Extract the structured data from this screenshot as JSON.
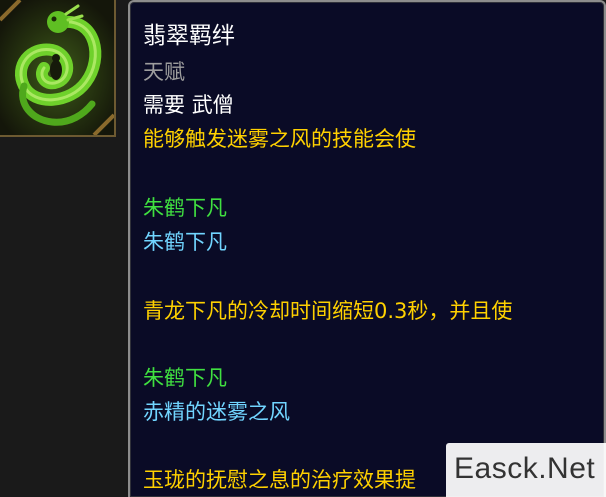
{
  "icon": {
    "name": "jade-serpent-icon"
  },
  "tooltip": {
    "title": "翡翠羁绊",
    "subtitle": "天赋",
    "requirement_prefix": "需要",
    "requirement_class": "武僧",
    "lines": [
      "能够触发迷雾之风的技能会使",
      "朱鹤下凡",
      "朱鹤下凡",
      "青龙下凡的冷却时间缩短0.3秒，并且使",
      "朱鹤下凡",
      "赤精的迷雾之风",
      "玉珑的抚慰之息的治疗效果提"
    ]
  },
  "colors": {
    "tooltip_bg": "#0a0b26",
    "title": "#ffffff",
    "subtitle": "#9d9d9d",
    "gold_text": "#ffd100",
    "green_text": "#40e040",
    "blue_text": "#71d5ff"
  },
  "watermark": {
    "text": "Easck.Net"
  }
}
